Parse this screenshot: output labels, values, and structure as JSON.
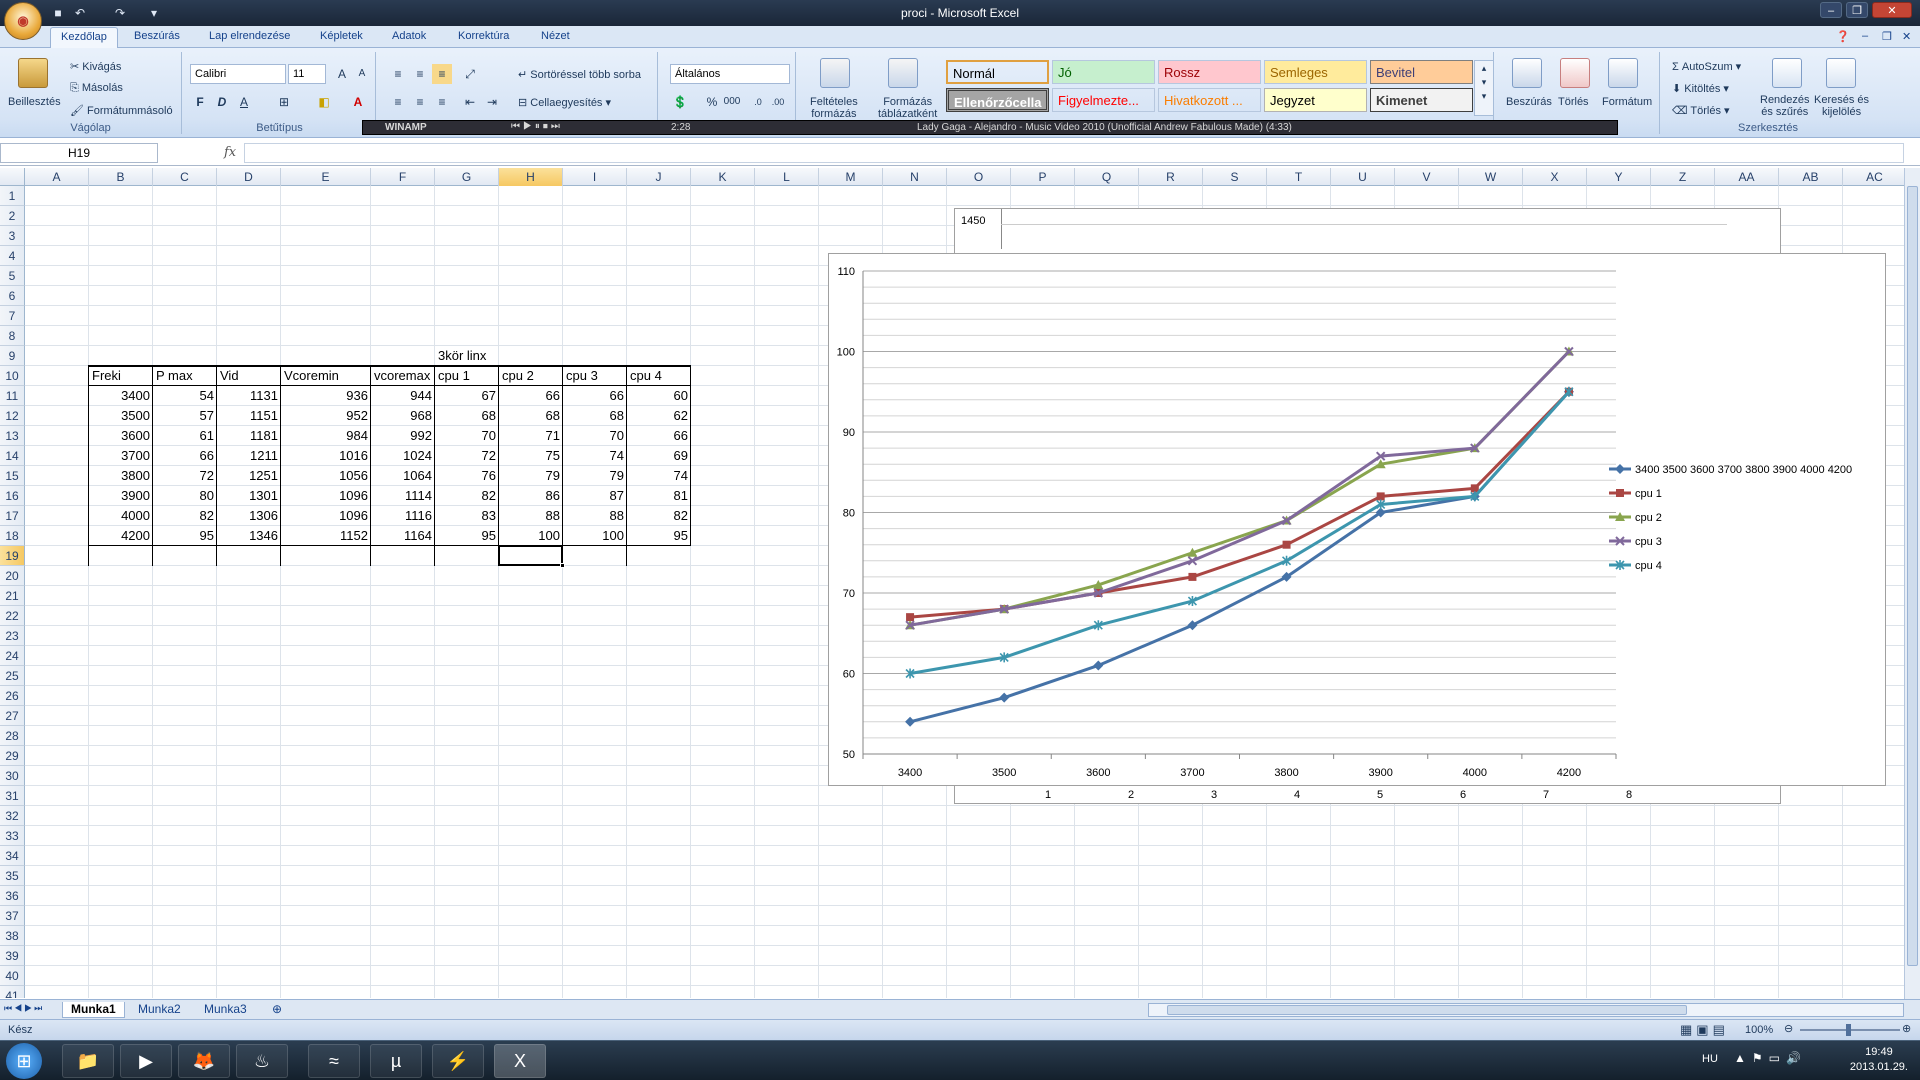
{
  "window": {
    "title": "proci - Microsoft Excel"
  },
  "ribbon": {
    "tabs": [
      "Kezdőlap",
      "Beszúrás",
      "Lap elrendezése",
      "Képletek",
      "Adatok",
      "Korrektúra",
      "Nézet"
    ],
    "clipboard": {
      "paste": "Beillesztés",
      "cut": "Kivágás",
      "copy": "Másolás",
      "format_painter": "Formátummásoló",
      "label": "Vágólap"
    },
    "font": {
      "name": "Calibri",
      "size": "11",
      "bold": "F",
      "italic": "D",
      "underline": "A",
      "label": "Betűtípus"
    },
    "alignment": {
      "wrap": "Sortöréssel több sorba",
      "merge": "Cellaegyesítés"
    },
    "number": {
      "format": "Általános",
      "percent": "%",
      "thousands": "000"
    },
    "styles": {
      "conditional": [
        "Feltételes",
        "formázás"
      ],
      "as_table": [
        "Formázás",
        "táblázatként"
      ],
      "cells": [
        {
          "label": "Normál",
          "bg": "#ffffff",
          "fg": "#000000"
        },
        {
          "label": "Jó",
          "bg": "#c6efce",
          "fg": "#006100"
        },
        {
          "label": "Rossz",
          "bg": "#ffc7ce",
          "fg": "#9c0006"
        },
        {
          "label": "Semleges",
          "bg": "#ffeb9c",
          "fg": "#9c6500"
        },
        {
          "label": "Bevitel",
          "bg": "#ffcc99",
          "fg": "#3f3f76"
        },
        {
          "label": "Ellenőrzőcella",
          "bg": "#a5a5a5",
          "fg": "#ffffff"
        },
        {
          "label": "Figyelmezte...",
          "bg": "#ffffff",
          "fg": "#ff0000"
        },
        {
          "label": "Hivatkozott ...",
          "bg": "#ffffff",
          "fg": "#fa7d00"
        },
        {
          "label": "Jegyzet",
          "bg": "#ffffcc",
          "fg": "#000000"
        },
        {
          "label": "Kimenet",
          "bg": "#f2f2f2",
          "fg": "#3f3f3f"
        }
      ]
    },
    "cells_group": {
      "insert": "Beszúrás",
      "delete": "Törlés",
      "format": "Formátum"
    },
    "editing": {
      "autosum": "AutoSzum",
      "fill": "Kitöltés",
      "clear": "Törlés",
      "sort": [
        "Rendezés",
        "és szűrés"
      ],
      "find": [
        "Keresés és",
        "kijelölés"
      ],
      "label": "Szerkesztés"
    }
  },
  "winamp": {
    "title": "WINAMP",
    "time": "2:28",
    "track": "Lady Gaga - Alejandro - Music Video 2010 (Unofficial Andrew Fabulous Made) (4:33)"
  },
  "formula_bar": {
    "name_box": "H19",
    "fx": "fx",
    "value": ""
  },
  "columns": [
    "A",
    "B",
    "C",
    "D",
    "E",
    "F",
    "G",
    "H",
    "I",
    "J",
    "K",
    "L",
    "M",
    "N",
    "O",
    "P",
    "Q",
    "R",
    "S",
    "T",
    "U",
    "V",
    "W",
    "X",
    "Y",
    "Z",
    "AA",
    "AB",
    "AC"
  ],
  "selected_column": "H",
  "rows": [
    1,
    2,
    3,
    4,
    5,
    6,
    7,
    8,
    9,
    10,
    11,
    12,
    13,
    14,
    15,
    16,
    17,
    18,
    19,
    20,
    21,
    22,
    23,
    24,
    25,
    26,
    27,
    28,
    29,
    30,
    31,
    32,
    33,
    34,
    35,
    36,
    37,
    38,
    39,
    40,
    41
  ],
  "selected_row": 19,
  "sheet": {
    "caption": "3kör linx",
    "headers": [
      "Freki",
      "P max",
      "Vid",
      "Vcoremin",
      "vcoremax",
      "cpu 1",
      "cpu 2",
      "cpu 3",
      "cpu 4"
    ],
    "data": [
      [
        "3400",
        "54",
        "1131",
        "936",
        "944",
        "67",
        "66",
        "66",
        "60"
      ],
      [
        "3500",
        "57",
        "1151",
        "952",
        "968",
        "68",
        "68",
        "68",
        "62"
      ],
      [
        "3600",
        "61",
        "1181",
        "984",
        "992",
        "70",
        "71",
        "70",
        "66"
      ],
      [
        "3700",
        "66",
        "1211",
        "1016",
        "1024",
        "72",
        "75",
        "74",
        "69"
      ],
      [
        "3800",
        "72",
        "1251",
        "1056",
        "1064",
        "76",
        "79",
        "79",
        "74"
      ],
      [
        "3900",
        "80",
        "1301",
        "1096",
        "1114",
        "82",
        "86",
        "87",
        "81"
      ],
      [
        "4000",
        "82",
        "1306",
        "1096",
        "1116",
        "83",
        "88",
        "88",
        "82"
      ],
      [
        "4200",
        "95",
        "1346",
        "1152",
        "1164",
        "95",
        "100",
        "100",
        "95"
      ]
    ]
  },
  "behind_chart": {
    "top_value": "1450",
    "xticks": [
      "1",
      "2",
      "3",
      "4",
      "5",
      "6",
      "7",
      "8"
    ]
  },
  "chart_data": {
    "type": "line",
    "categories": [
      "3400",
      "3500",
      "3600",
      "3700",
      "3800",
      "3900",
      "4000",
      "4200"
    ],
    "ylim": [
      50,
      110
    ],
    "yticks": [
      "50",
      "60",
      "70",
      "80",
      "90",
      "100",
      "110"
    ],
    "grid": true,
    "legend_position": "right",
    "series": [
      {
        "name": "3400 3500 3600 3700 3800 3900 4000 4200",
        "color": "#4572a7",
        "marker": "diamond",
        "values": [
          54,
          57,
          61,
          66,
          72,
          80,
          82,
          95
        ]
      },
      {
        "name": "cpu 1",
        "color": "#aa4643",
        "marker": "square",
        "values": [
          67,
          68,
          70,
          72,
          76,
          82,
          83,
          95
        ]
      },
      {
        "name": "cpu 2",
        "color": "#89a54e",
        "marker": "triangle",
        "values": [
          66,
          68,
          71,
          75,
          79,
          86,
          88,
          100
        ]
      },
      {
        "name": "cpu 3",
        "color": "#80699b",
        "marker": "x",
        "values": [
          66,
          68,
          70,
          74,
          79,
          87,
          88,
          100
        ]
      },
      {
        "name": "cpu 4",
        "color": "#3d96ae",
        "marker": "star",
        "values": [
          60,
          62,
          66,
          69,
          74,
          81,
          82,
          95
        ]
      }
    ]
  },
  "sheet_tabs": [
    "Munka1",
    "Munka2",
    "Munka3"
  ],
  "status": {
    "ready": "Kész",
    "zoom": "100%"
  },
  "taskbar": {
    "lang": "HU",
    "time": "19:49",
    "date": "2013.01.29."
  }
}
